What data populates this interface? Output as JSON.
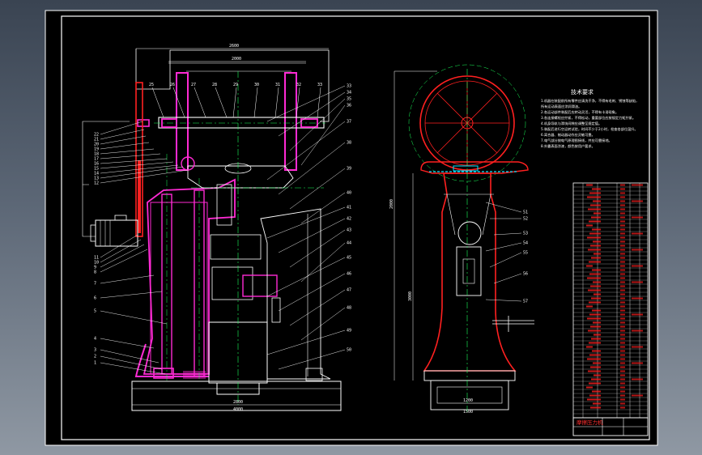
{
  "colors": {
    "sheet": "#000000",
    "outline": "#ffffff",
    "part": "#ff2ad4",
    "center": "#19ff5a",
    "leader": "#ffffff",
    "red": "#ff2020",
    "cyan": "#00e5ff",
    "yellow": "#ffe600"
  },
  "front_view": {
    "dims": [
      "2600",
      "2000",
      "2800",
      "4000"
    ],
    "top_labels": [
      "25",
      "26",
      "27",
      "28",
      "29",
      "30",
      "31",
      "32",
      "33"
    ],
    "left_labels": [
      "22",
      "21",
      "20",
      "19",
      "18",
      "17",
      "16",
      "15",
      "14",
      "13",
      "12",
      "11",
      "10",
      "9",
      "8",
      "7",
      "6",
      "5",
      "4",
      "3",
      "2",
      "1"
    ],
    "right_labels": [
      "33",
      "34",
      "35",
      "36",
      "37",
      "38",
      "39",
      "40",
      "41",
      "42",
      "43",
      "44",
      "45",
      "46",
      "47",
      "48",
      "49",
      "50"
    ]
  },
  "side_view": {
    "dims": [
      "2000",
      "3000",
      "1200",
      "1500"
    ],
    "labels": [
      "51",
      "52",
      "53",
      "54",
      "55",
      "56",
      "57"
    ]
  },
  "notes": {
    "title": "技术要求",
    "lines": [
      "1.机器在装配前所有零件应清洗干净，不得有毛刺、锈蚀等缺陷，",
      "  所有运动表面应涂润滑油。",
      "2.各运动部件装配后应转动灵活，不得有卡滞现象。",
      "3.各连接螺栓应拧紧，不得松动，重要部位应按规定力矩拧紧。",
      "4.机身导轨与滑块间隙应调整至规定值。",
      "5.装配后进行空运转试验，时间不少于2小时，检查各部位温升。",
      "6.离合器、制动器动作应灵敏可靠。",
      "7.电气部分按电气原理图接线，并应可靠接地。",
      "8.外露表面涂漆，颜色按用户要求。"
    ]
  },
  "title_block": {
    "name": "摩擦压力机"
  }
}
